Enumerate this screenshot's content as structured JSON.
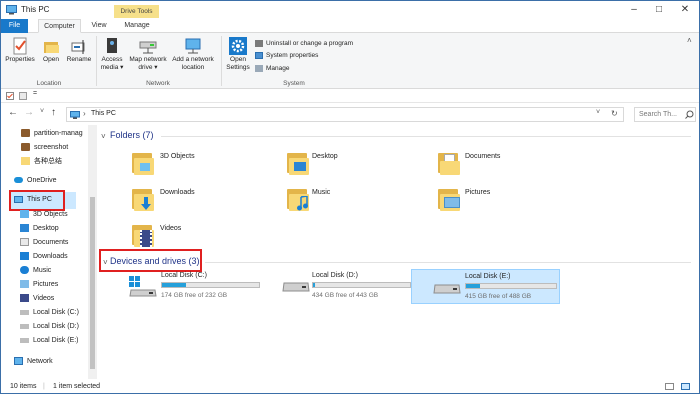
{
  "window": {
    "title": "This PC",
    "context_tab_header": "Drive Tools",
    "controls": [
      "–",
      "□",
      "✕"
    ]
  },
  "tabs": [
    {
      "label": "File"
    },
    {
      "label": "Computer"
    },
    {
      "label": "View"
    },
    {
      "label": "Manage"
    }
  ],
  "ribbon": {
    "location": {
      "group_label": "Location",
      "buttons": [
        {
          "label": "Properties",
          "icon": "checkmark-properties-icon"
        },
        {
          "label": "Open",
          "icon": "open-folder-icon"
        },
        {
          "label": "Rename",
          "icon": "rename-icon"
        }
      ]
    },
    "network": {
      "group_label": "Network",
      "access_media": {
        "line1": "Access",
        "line2": "media ▾"
      },
      "map_drive": {
        "line1": "Map network",
        "line2": "drive ▾"
      },
      "add_location": {
        "line1": "Add a network",
        "line2": "location"
      }
    },
    "system": {
      "group_label": "System",
      "open_settings": {
        "line1": "Open",
        "line2": "Settings"
      },
      "items": [
        {
          "label": "Uninstall or change a program"
        },
        {
          "label": "System properties"
        },
        {
          "label": "Manage"
        }
      ]
    }
  },
  "qat": {
    "dropdown": "="
  },
  "nav": {
    "back": "←",
    "forward": "→",
    "recent": "˅",
    "up": "↑",
    "address_sep": "›",
    "address": "This PC",
    "address_dropdown": "˅",
    "refresh": "↻",
    "search_placeholder": "Search Th..."
  },
  "sidebar": {
    "quick_items": [
      {
        "label": "partition-manag",
        "icon": "app-icon"
      },
      {
        "label": "screenshot",
        "icon": "app-icon"
      },
      {
        "label": "各种总结",
        "icon": "folder-icon"
      }
    ],
    "onedrive": "OneDrive",
    "this_pc": "This PC",
    "pc_items": [
      {
        "label": "3D Objects",
        "icon": "3d-objects-icon"
      },
      {
        "label": "Desktop",
        "icon": "desktop-icon"
      },
      {
        "label": "Documents",
        "icon": "documents-icon"
      },
      {
        "label": "Downloads",
        "icon": "downloads-icon"
      },
      {
        "label": "Music",
        "icon": "music-icon"
      },
      {
        "label": "Pictures",
        "icon": "pictures-icon"
      },
      {
        "label": "Videos",
        "icon": "videos-icon"
      },
      {
        "label": "Local Disk (C:)",
        "icon": "drive-icon"
      },
      {
        "label": "Local Disk (D:)",
        "icon": "drive-icon"
      },
      {
        "label": "Local Disk (E:)",
        "icon": "drive-icon"
      }
    ],
    "network": "Network"
  },
  "folders_section": {
    "title": "Folders (7)",
    "items": [
      {
        "label": "3D Objects"
      },
      {
        "label": "Desktop"
      },
      {
        "label": "Documents"
      },
      {
        "label": "Downloads"
      },
      {
        "label": "Music"
      },
      {
        "label": "Pictures"
      },
      {
        "label": "Videos"
      }
    ]
  },
  "devices_section": {
    "title": "Devices and drives (3)",
    "drives": [
      {
        "label": "Local Disk (C:)",
        "free": "174 GB free of 232 GB",
        "used_fraction": 0.25
      },
      {
        "label": "Local Disk (D:)",
        "free": "434 GB free of 443 GB",
        "used_fraction": 0.02
      },
      {
        "label": "Local Disk (E:)",
        "free": "415 GB free of 488 GB",
        "used_fraction": 0.15
      }
    ]
  },
  "status": {
    "items": "10 items",
    "selected": "1 item selected"
  },
  "colors": {
    "accent": "#1979ca",
    "selection": "#cce8ff",
    "highlight_box": "#e02020",
    "bar_fill": "#26a0da"
  }
}
